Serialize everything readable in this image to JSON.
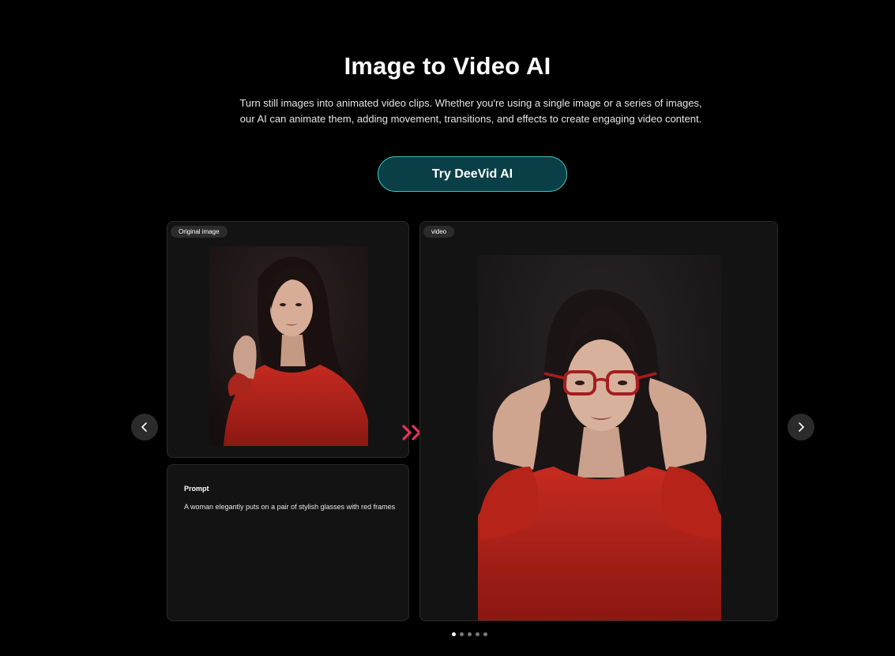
{
  "hero": {
    "title": "Image to Video AI",
    "description_line1": "Turn still images into animated video clips. Whether you're using a single image or a series of images,",
    "description_line2": "our AI can animate them, adding movement, transitions, and effects to create engaging video content.",
    "cta_label": "Try DeeVid AI"
  },
  "colors": {
    "background": "#000000",
    "card": "#131313",
    "cta_fill": "#0a3f47",
    "cta_border": "#3ec2b4",
    "chevron_accent": "#e8335a",
    "sweater_red": "#b5201a"
  },
  "original_card": {
    "tag": "Original image"
  },
  "prompt_card": {
    "title": "Prompt",
    "text": "A woman elegantly puts on a pair of stylish glasses with red frames"
  },
  "video_card": {
    "tag": "video"
  },
  "icons": {
    "arrow": "double-chevron-right-icon",
    "prev": "chevron-left-icon",
    "next": "chevron-right-icon"
  },
  "carousel": {
    "slide_count": 5,
    "active_index": 0
  }
}
